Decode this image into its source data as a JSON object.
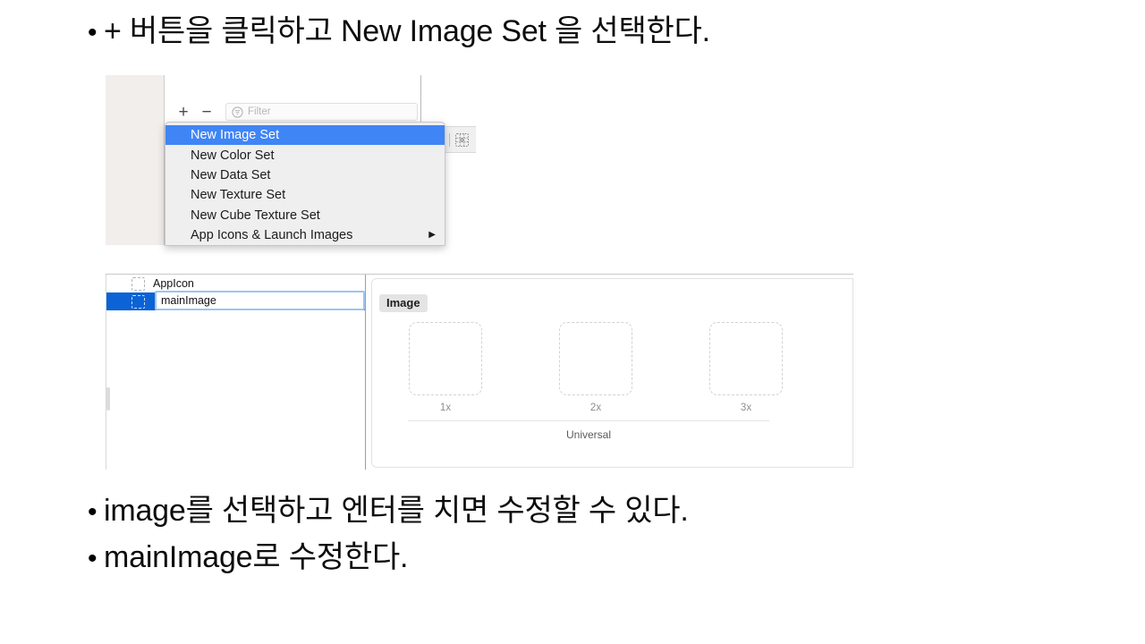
{
  "slide": {
    "bullet_char": "•",
    "lines": [
      {
        "id": "top",
        "text": "+ 버튼을 클릭하고 New Image Set 을 선택한다."
      },
      {
        "id": "mid",
        "text": "image를 선택하고 엔터를 치면 수정할 수 있다."
      },
      {
        "id": "last",
        "text": "mainImage로 수정한다."
      }
    ]
  },
  "screenshot_menu": {
    "toolbar": {
      "add_label": "+",
      "remove_label": "−",
      "filter_icon": "filter-icon",
      "filter_placeholder": "Filter",
      "grid_icon": "grid-view-icon"
    },
    "popup_menu": {
      "items": [
        {
          "label": "New Image Set",
          "selected": true,
          "submenu": false
        },
        {
          "label": "New Color Set",
          "selected": false,
          "submenu": false
        },
        {
          "label": "New Data Set",
          "selected": false,
          "submenu": false
        },
        {
          "label": "New Texture Set",
          "selected": false,
          "submenu": false
        },
        {
          "label": "New Cube Texture Set",
          "selected": false,
          "submenu": false
        },
        {
          "label": "App Icons & Launch Images",
          "selected": false,
          "submenu": true
        }
      ],
      "submenu_arrow": "▶",
      "highlight_color": "#3f85f6"
    }
  },
  "screenshot_catalog": {
    "asset_list": {
      "rows": [
        {
          "label": "AppIcon",
          "selected": false,
          "editing": false
        },
        {
          "label": "mainImage",
          "selected": true,
          "editing": true
        }
      ],
      "selection_color": "#0b63d6",
      "focus_ring_color": "#9cc4f5"
    },
    "detail_pane": {
      "title": "Image",
      "slots": [
        {
          "caption": "1x",
          "filled": false
        },
        {
          "caption": "2x",
          "filled": false
        },
        {
          "caption": "3x",
          "filled": false
        }
      ],
      "footer": "Universal"
    }
  }
}
